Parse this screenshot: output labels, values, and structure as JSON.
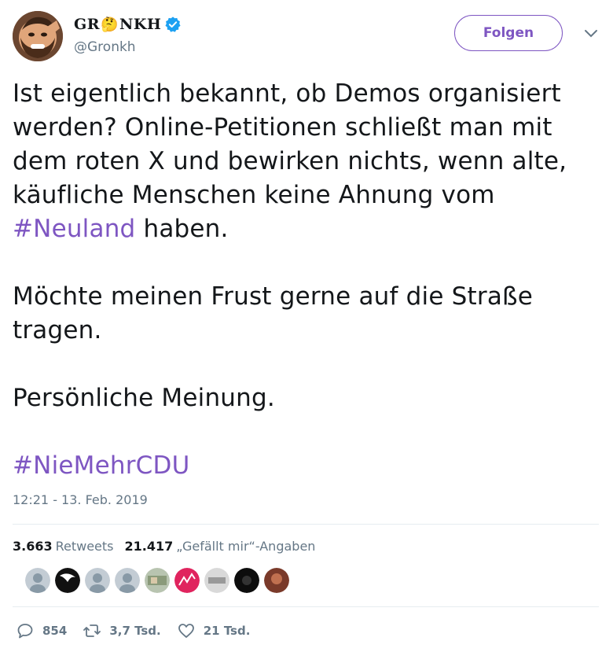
{
  "user": {
    "display_name_left": "GR",
    "display_name_emoji": "🤔",
    "display_name_right": "NKH",
    "handle": "@Gronkh",
    "verified": true
  },
  "follow_button": {
    "label": "Folgen"
  },
  "tweet": {
    "paragraph1_text": "Ist eigentlich bekannt, ob Demos organisiert werden? Online-Petitionen schließt man mit dem roten X und bewirken nichts, wenn alte, käufliche Menschen keine Ahnung vom ",
    "paragraph1_hashtag": "#Neuland",
    "paragraph1_end": " haben.",
    "paragraph2": "Möchte meinen Frust gerne auf die Straße tragen.",
    "paragraph3": "Persönliche Meinung.",
    "hashtag2": "#NieMehrCDU",
    "timestamp": "12:21 - 13. Feb. 2019"
  },
  "stats": {
    "retweets_count": "3.663",
    "retweets_label": "Retweets",
    "likes_count": "21.417",
    "likes_label": "„Gefällt mir“-Angaben"
  },
  "actions": {
    "replies": "854",
    "retweets": "3,7 Tsd.",
    "likes": "21 Tsd."
  },
  "colors": {
    "accent": "#7e56c2",
    "text": "#14171a",
    "muted": "#657786",
    "verified": "#1da1f2"
  }
}
